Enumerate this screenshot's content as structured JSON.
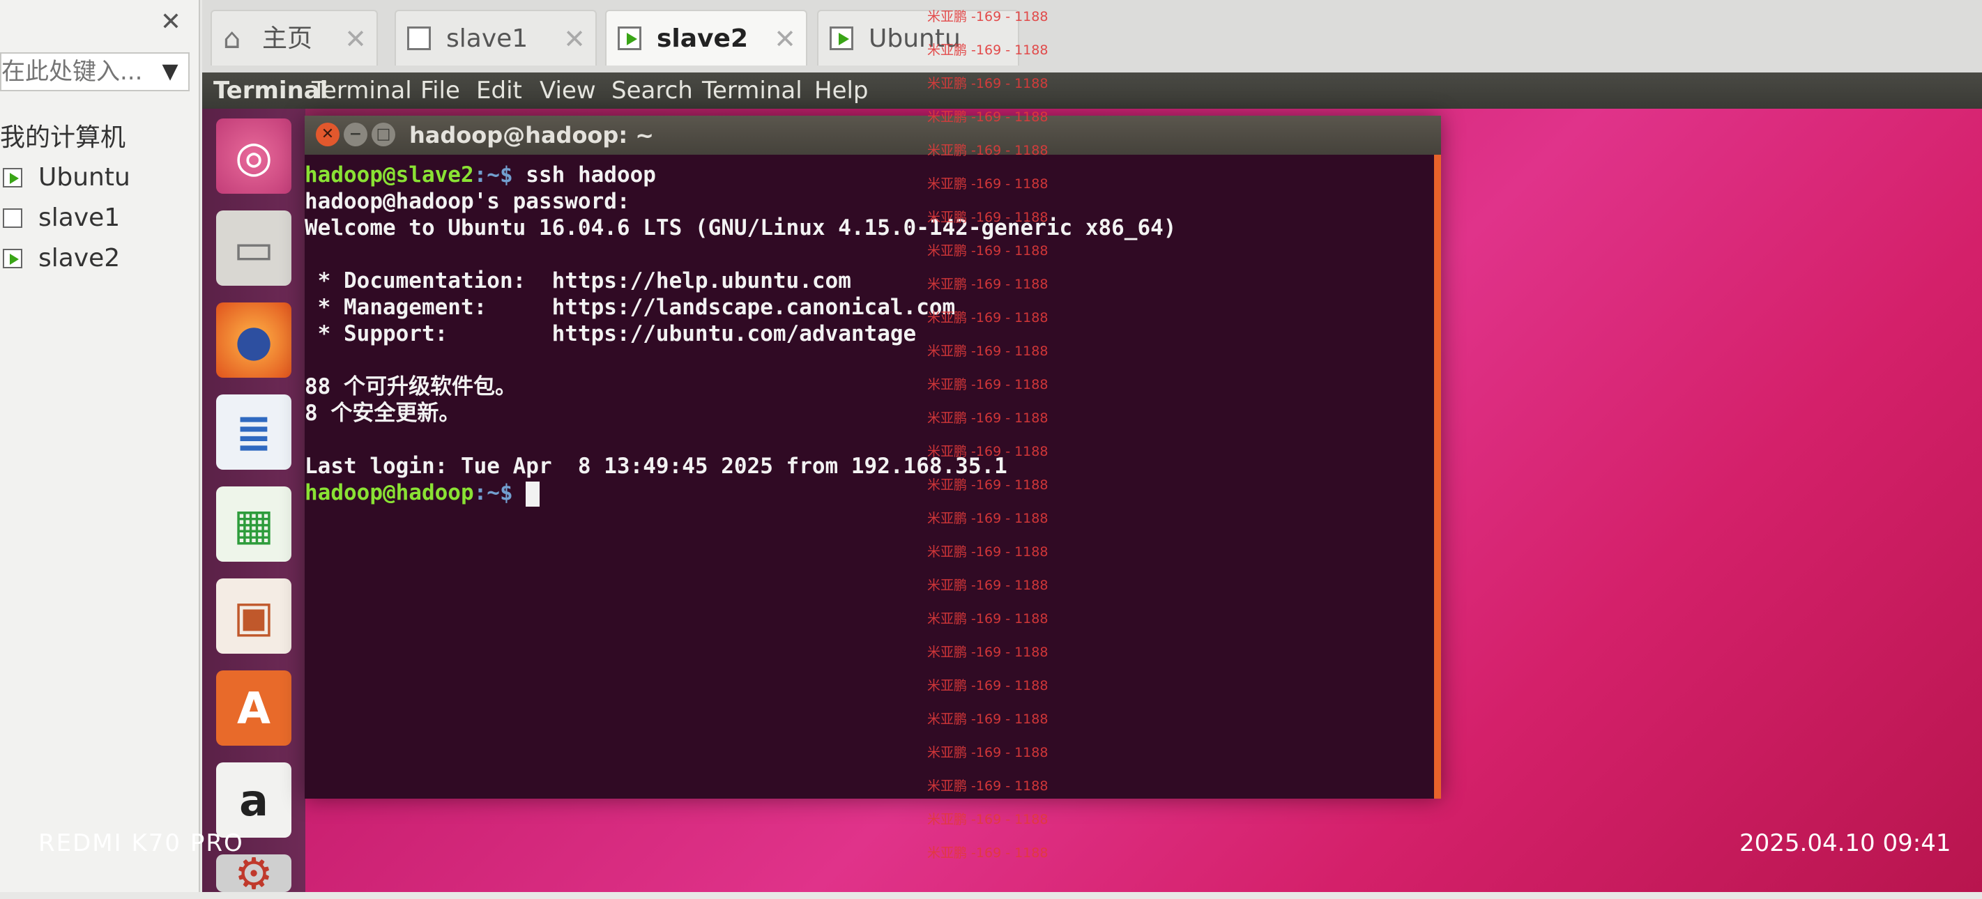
{
  "library": {
    "close": "✕",
    "search_placeholder": "在此处键入...",
    "root": "我的计算机",
    "items": [
      {
        "label": "Ubuntu",
        "running": true
      },
      {
        "label": "slave1",
        "running": false
      },
      {
        "label": "slave2",
        "running": true
      }
    ]
  },
  "tabs": [
    {
      "label": "主页",
      "close": "✕"
    },
    {
      "label": "slave1",
      "close": "✕"
    },
    {
      "label": "slave2",
      "close": "✕"
    },
    {
      "label": "Ubuntu",
      "close": ""
    }
  ],
  "topbar": {
    "app_name": "Terminal",
    "menus": [
      "Terminal",
      "File",
      "Edit",
      "View",
      "Search",
      "Terminal",
      "Help"
    ]
  },
  "terminal": {
    "title": "hadoop@hadoop: ~",
    "lines": {
      "l1_user": "hadoop@slave2",
      "l1_path": ":~$",
      "l1_cmd": " ssh hadoop",
      "l2": "hadoop@hadoop's password:",
      "l3": "Welcome to Ubuntu 16.04.6 LTS (GNU/Linux 4.15.0-142-generic x86_64)",
      "l5": " * Documentation:  https://help.ubuntu.com",
      "l6": " * Management:     https://landscape.canonical.com",
      "l7": " * Support:        https://ubuntu.com/advantage",
      "l9": "88 个可升级软件包。",
      "l10": "8 个安全更新。",
      "l12": "Last login: Tue Apr  8 13:49:45 2025 from 192.168.35.1",
      "l13_user": "hadoop@hadoop",
      "l13_path": ":~$"
    }
  },
  "watermark_text": "米亚鹏 -169 - 1188",
  "camera": {
    "model": "REDMI K70 PRO",
    "timestamp": "2025.04.10 09:41"
  },
  "colors": {
    "prompt_user": "#8ae234",
    "prompt_path": "#729fcf",
    "terminal_bg": "#300a24",
    "watermark": "#e23b3b"
  }
}
